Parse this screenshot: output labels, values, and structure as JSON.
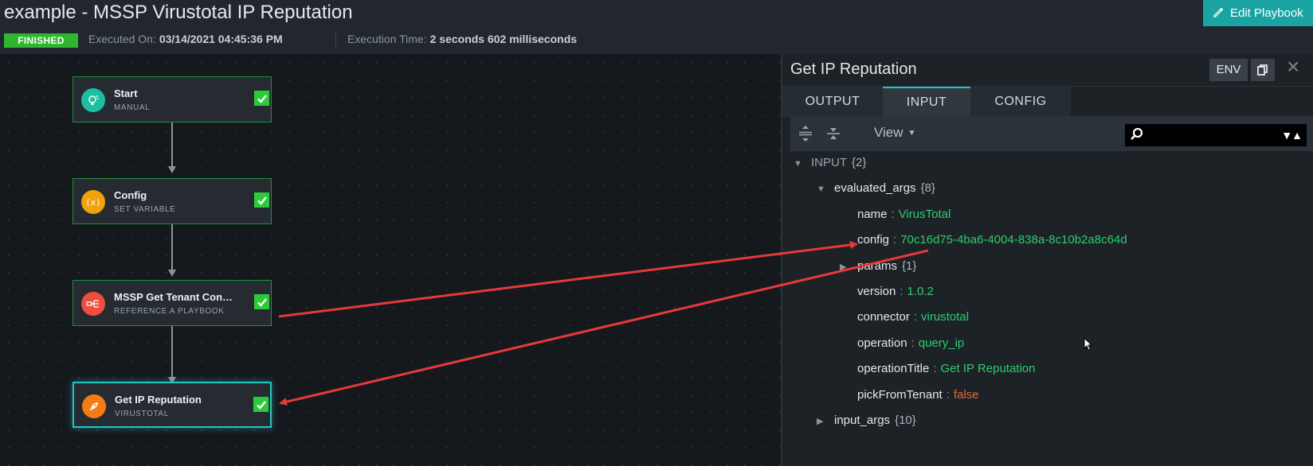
{
  "header": {
    "title": "example - MSSP Virustotal IP Reputation",
    "status": "FINISHED",
    "executed_on_label": "Executed On:",
    "executed_on_value": "03/14/2021 04:45:36 PM",
    "execution_time_label": "Execution Time:",
    "execution_time_value": "2 seconds 602 milliseconds",
    "edit_button": "Edit Playbook"
  },
  "nodes": [
    {
      "title": "Start",
      "subtitle": "MANUAL",
      "icon": "lightbulb-icon",
      "color": "#1dbfa3"
    },
    {
      "title": "Config",
      "subtitle": "SET VARIABLE",
      "icon": "variable-icon",
      "color": "#f0a30a"
    },
    {
      "title": "MSSP Get Tenant Connect...",
      "subtitle": "REFERENCE A PLAYBOOK",
      "icon": "playbook-reference-icon",
      "color": "#ef4e3e"
    },
    {
      "title": "Get IP Reputation",
      "subtitle": "VIRUSTOTAL",
      "icon": "rocket-icon",
      "color": "#f57c13"
    }
  ],
  "panel": {
    "title": "Get IP Reputation",
    "env_button": "ENV",
    "close": "×",
    "tabs": [
      "OUTPUT",
      "INPUT",
      "CONFIG"
    ],
    "active_tab": "INPUT",
    "view_label": "View",
    "search_value": ""
  },
  "tree": {
    "root_key": "INPUT",
    "root_count": "{2}",
    "evaluated_args_key": "evaluated_args",
    "evaluated_args_count": "{8}",
    "fields": [
      {
        "key": "name",
        "value": "VirusTotal",
        "type": "string"
      },
      {
        "key": "config",
        "value": "70c16d75-4ba6-4004-838a-8c10b2a8c64d",
        "type": "string"
      },
      {
        "key": "params",
        "value": "{1}",
        "type": "object"
      },
      {
        "key": "version",
        "value": "1.0.2",
        "type": "string"
      },
      {
        "key": "connector",
        "value": "virustotal",
        "type": "string"
      },
      {
        "key": "operation",
        "value": "query_ip",
        "type": "string"
      },
      {
        "key": "operationTitle",
        "value": "Get IP Reputation",
        "type": "string"
      },
      {
        "key": "pickFromTenant",
        "value": "false",
        "type": "boolean"
      }
    ],
    "input_args_key": "input_args",
    "input_args_count": "{10}"
  },
  "colors": {
    "accent": "#22c7c1",
    "success": "#2bcc3a",
    "string_value": "#2ecc71",
    "boolean_value": "#e1693a",
    "annotation_arrow": "#e5393b"
  }
}
